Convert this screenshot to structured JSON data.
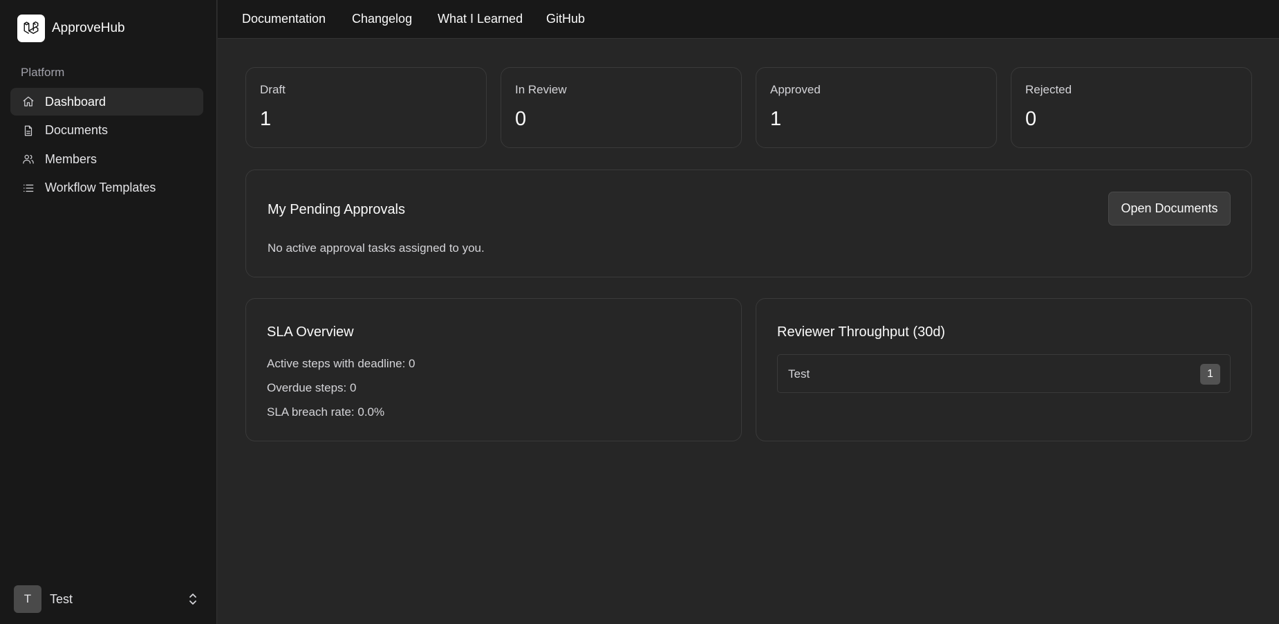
{
  "brand": {
    "name": "ApproveHub",
    "logo_icon": "laravel-logo-icon"
  },
  "sidebar": {
    "section_label": "Platform",
    "items": [
      {
        "label": "Dashboard",
        "icon": "home-icon",
        "active": true
      },
      {
        "label": "Documents",
        "icon": "document-icon",
        "active": false
      },
      {
        "label": "Members",
        "icon": "users-icon",
        "active": false
      },
      {
        "label": "Workflow Templates",
        "icon": "list-icon",
        "active": false
      }
    ],
    "user": {
      "initial": "T",
      "name": "Test"
    }
  },
  "topnav": [
    "Documentation",
    "Changelog",
    "What I Learned",
    "GitHub"
  ],
  "stats": [
    {
      "label": "Draft",
      "value": "1"
    },
    {
      "label": "In Review",
      "value": "0"
    },
    {
      "label": "Approved",
      "value": "1"
    },
    {
      "label": "Rejected",
      "value": "0"
    }
  ],
  "pending": {
    "title": "My Pending Approvals",
    "empty_text": "No active approval tasks assigned to you.",
    "button_label": "Open Documents"
  },
  "sla": {
    "title": "SLA Overview",
    "lines": [
      "Active steps with deadline: 0",
      "Overdue steps: 0",
      "SLA breach rate: 0.0%"
    ]
  },
  "throughput": {
    "title": "Reviewer Throughput (30d)",
    "rows": [
      {
        "name": "Test",
        "count": "1"
      }
    ]
  },
  "colors": {
    "background": "#262626",
    "sidebar": "#181818",
    "border": "#3a3a3a",
    "text": "#fafafa"
  }
}
